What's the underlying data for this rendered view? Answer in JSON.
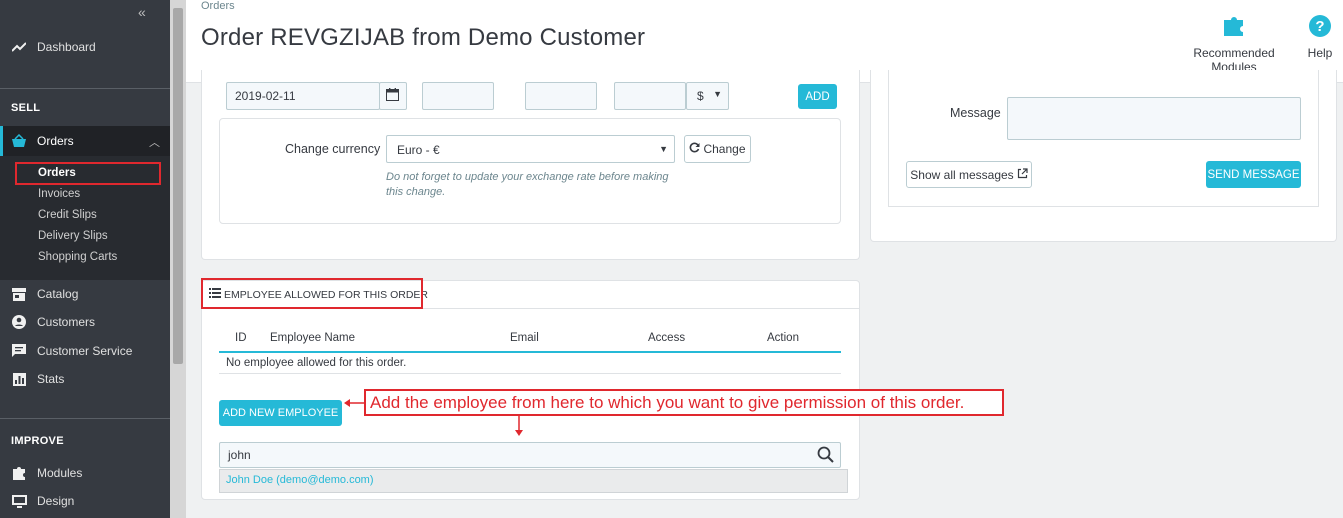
{
  "sidebar": {
    "collapse_icon": "«",
    "dashboard": "Dashboard",
    "sell_title": "SELL",
    "orders": "Orders",
    "sub_items": [
      "Orders",
      "Invoices",
      "Credit Slips",
      "Delivery Slips",
      "Shopping Carts"
    ],
    "catalog": "Catalog",
    "customers": "Customers",
    "customer_service": "Customer Service",
    "stats": "Stats",
    "improve_title": "IMPROVE",
    "modules": "Modules",
    "design": "Design"
  },
  "header": {
    "breadcrumb": "Orders",
    "title": "Order REVGZIJAB from Demo Customer",
    "recommended_modules": "Recommended Modules",
    "help": "Help"
  },
  "payment_row": {
    "date": "2019-02-11",
    "currency_symbol": "$",
    "add_label": "ADD"
  },
  "currency": {
    "label": "Change currency",
    "selected": "Euro - €",
    "change_label": "Change",
    "help_line1": "Do not forget to update your exchange rate before making",
    "help_line2": "this change."
  },
  "messages": {
    "label": "Message",
    "show_all": "Show all messages",
    "send": "SEND MESSAGE"
  },
  "employees": {
    "title": "EMPLOYEE ALLOWED FOR THIS ORDER",
    "columns": [
      "ID",
      "Employee Name",
      "Email",
      "Access",
      "Action"
    ],
    "empty": "No employee allowed for this order.",
    "add_button": "ADD NEW EMPLOYEE",
    "search_value": "john",
    "suggestion": "John Doe (demo@demo.com)"
  },
  "annotation": "Add the employee from here to which you want to give permission of this order.",
  "colors": {
    "accent": "#25b9d7",
    "annotation": "#e0282e",
    "sidebar": "#363a41"
  }
}
